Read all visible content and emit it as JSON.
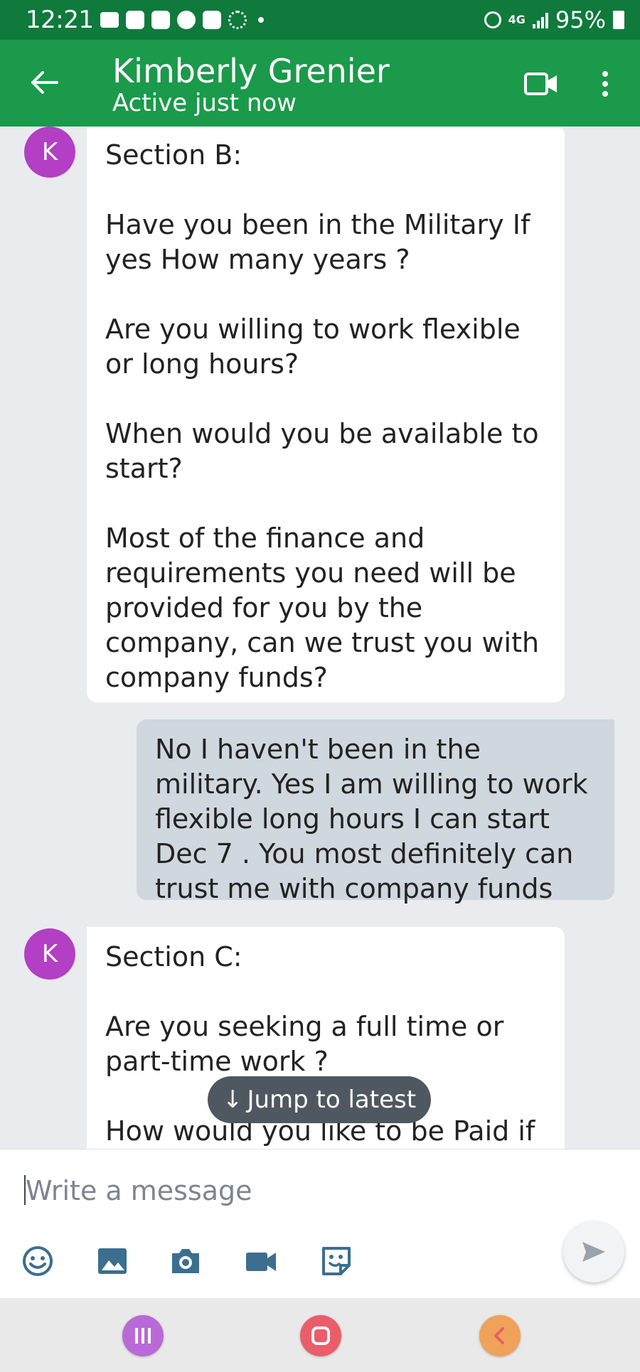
{
  "status_bar": {
    "time": "12:21",
    "network": "4G",
    "battery": "95%"
  },
  "header": {
    "contact_name": "Kimberly Grenier",
    "contact_status": "Active just now",
    "accent_color": "#1a9a4a"
  },
  "messages": [
    {
      "direction": "incoming",
      "avatar": "K",
      "text": "Section B:\n\nHave you been in the Military If yes How many years ?\n\nAre you willing to work flexible or long hours?\n\nWhen would you be available to start?\n\nMost of the finance and requirements you need will be provided for you by the company, can we trust you with company funds?"
    },
    {
      "direction": "outgoing",
      "text": "No I haven't been in the military. Yes I am willing to work flexible long hours I can start Dec 7 . You most definitely can trust me with company funds"
    },
    {
      "direction": "incoming",
      "avatar": "K",
      "text": "Section C:\n\nAre you seeking a full time or part-time work ?\n\nHow would you like to be Paid if"
    }
  ],
  "jump_button": {
    "label": "Jump to latest"
  },
  "composer": {
    "placeholder": "Write a message",
    "tools": [
      "emoji-icon",
      "image-icon",
      "camera-icon",
      "video-icon",
      "sticker-icon"
    ]
  },
  "nav": {
    "buttons": [
      "recents-icon",
      "home-icon",
      "back-icon"
    ]
  }
}
